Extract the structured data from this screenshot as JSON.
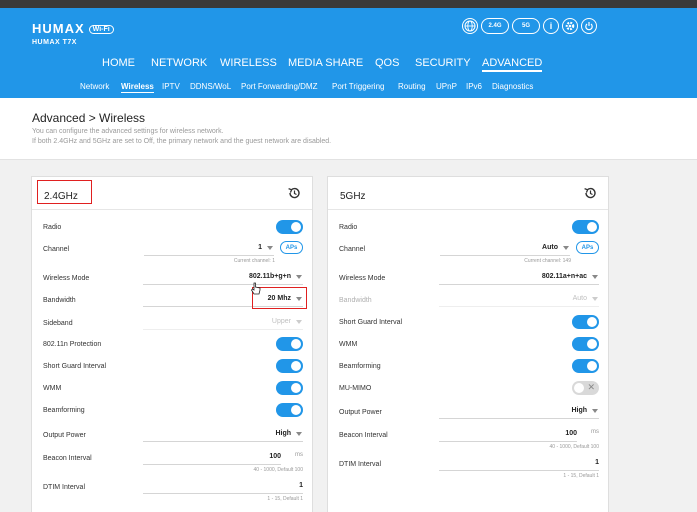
{
  "header": {
    "brand": "HUMAX",
    "brand_badge": "Wi-Fi",
    "model": "HUMAX T7X",
    "icons": [
      "globe-icon",
      "2.4G-wifi-icon",
      "5G-wifi-icon",
      "info-icon",
      "settings-icon",
      "power-icon"
    ],
    "icon_labels": {
      "wifi24": "2.4G",
      "wifi5": "5G",
      "info": "i"
    }
  },
  "nav": {
    "items": [
      "HOME",
      "NETWORK",
      "WIRELESS",
      "MEDIA SHARE",
      "QOS",
      "SECURITY",
      "ADVANCED"
    ],
    "active": "ADVANCED"
  },
  "subnav": {
    "items": [
      "Network",
      "Wireless",
      "IPTV",
      "DDNS/WoL",
      "Port Forwarding/DMZ",
      "Port Triggering",
      "Routing",
      "UPnP",
      "IPv6",
      "Diagnostics"
    ],
    "active": "Wireless"
  },
  "page": {
    "title": "Advanced > Wireless",
    "desc1": "You can configure the advanced settings for wireless network.",
    "desc2": "If both 2.4GHz and 5GHz are set to Off, the primary network and the guest network are disabled."
  },
  "panel24": {
    "title": "2.4GHz",
    "radio": {
      "label": "Radio",
      "on": true
    },
    "channel": {
      "label": "Channel",
      "value": "1",
      "aps": "APs",
      "hint": "Current channel: 1"
    },
    "mode": {
      "label": "Wireless Mode",
      "value": "802.11b+g+n"
    },
    "bandwidth": {
      "label": "Bandwidth",
      "value": "20 Mhz"
    },
    "sideband": {
      "label": "Sideband",
      "value": "Upper"
    },
    "protection": {
      "label": "802.11n Protection",
      "on": true
    },
    "sgi": {
      "label": "Short Guard Interval",
      "on": true
    },
    "wmm": {
      "label": "WMM",
      "on": true
    },
    "beamforming": {
      "label": "Beamforming",
      "on": true
    },
    "power": {
      "label": "Output Power",
      "value": "High"
    },
    "beacon": {
      "label": "Beacon Interval",
      "value": "100",
      "unit": "ms",
      "hint": "40 - 1000, Default 100"
    },
    "dtim": {
      "label": "DTIM Interval",
      "value": "1",
      "hint": "1 - 15, Default 1"
    }
  },
  "panel5": {
    "title": "5GHz",
    "radio": {
      "label": "Radio",
      "on": true
    },
    "channel": {
      "label": "Channel",
      "value": "Auto",
      "aps": "APs",
      "hint": "Current channel: 149"
    },
    "mode": {
      "label": "Wireless Mode",
      "value": "802.11a+n+ac"
    },
    "bandwidth": {
      "label": "Bandwidth",
      "value": "Auto"
    },
    "sgi": {
      "label": "Short Guard Interval",
      "on": true
    },
    "wmm": {
      "label": "WMM",
      "on": true
    },
    "beamforming": {
      "label": "Beamforming",
      "on": true
    },
    "mumimo": {
      "label": "MU-MIMO",
      "on": false
    },
    "power": {
      "label": "Output Power",
      "value": "High"
    },
    "beacon": {
      "label": "Beacon Interval",
      "value": "100",
      "unit": "ms",
      "hint": "40 - 1000, Default 100"
    },
    "dtim": {
      "label": "DTIM Interval",
      "value": "1",
      "hint": "1 - 15, Default 1"
    }
  },
  "colors": {
    "accent": "#2196e8",
    "highlight": "#e02020"
  }
}
